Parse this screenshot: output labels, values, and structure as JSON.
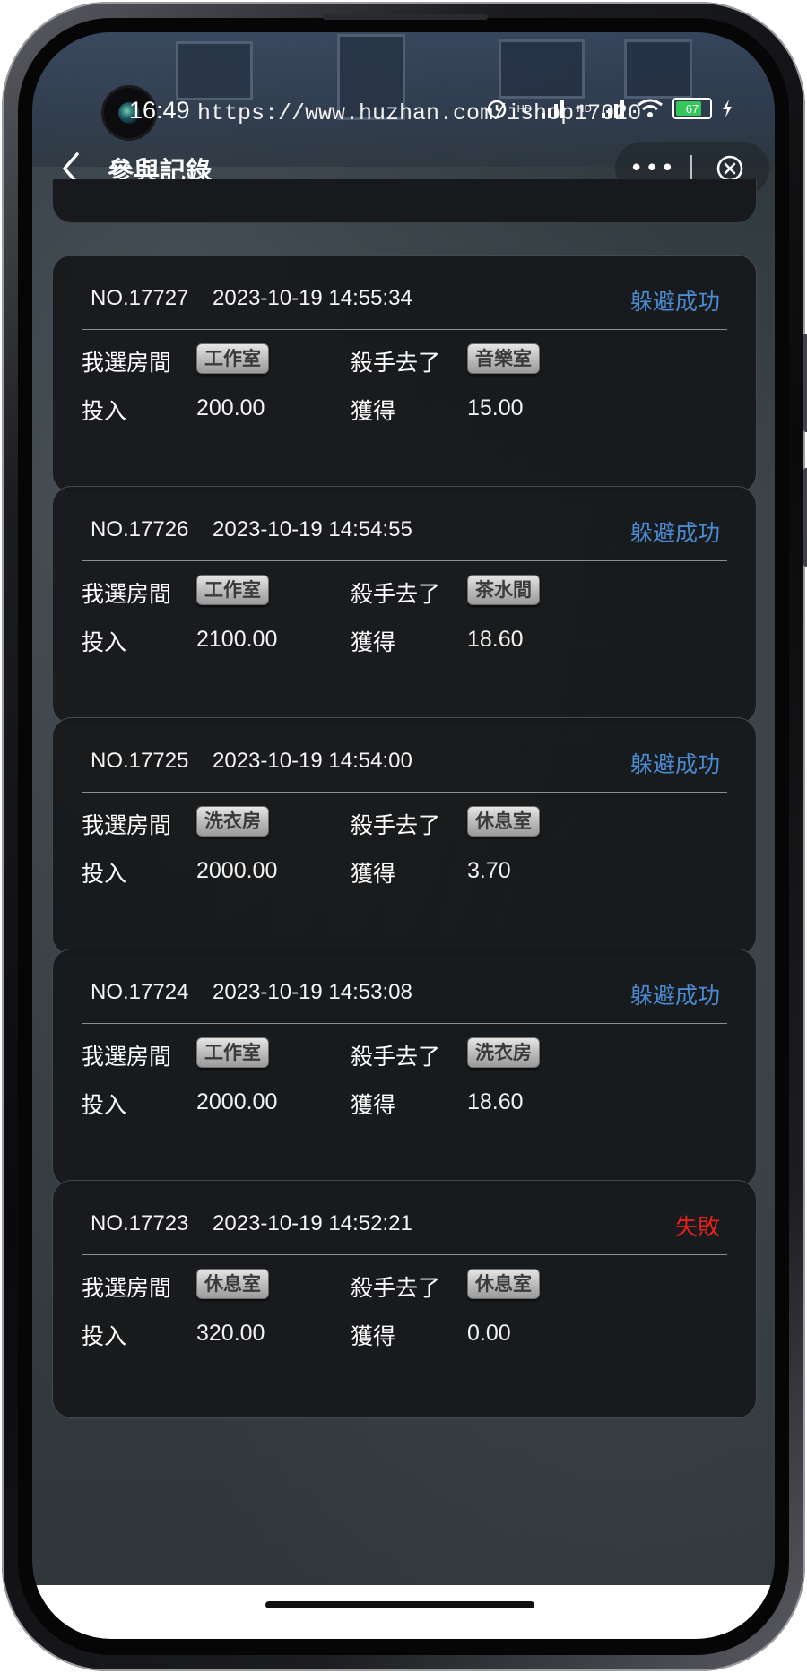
{
  "status_bar": {
    "time": "16:49",
    "watermark": "https://www.huzhan.com/ishop17020",
    "battery": "67",
    "icons": [
      "alarm-icon",
      "signal-icon",
      "wifi-icon",
      "battery-icon",
      "charging-icon"
    ],
    "hd1": "HD",
    "hd2": "HD"
  },
  "nav": {
    "title": "參與記錄",
    "more": "•••"
  },
  "colors": {
    "success": "#4a8bd1",
    "fail": "#e8221b"
  },
  "labels": {
    "my_room": "我選房間",
    "killer_went": "殺手去了",
    "invest": "投入",
    "gain": "獲得"
  },
  "records": [
    {
      "no": "NO.17727",
      "time": "2023-10-19 14:55:34",
      "status": "躲避成功",
      "my_room": "工作室",
      "killer_room": "音樂室",
      "invest": "200.00",
      "gain": "15.00"
    },
    {
      "no": "NO.17726",
      "time": "2023-10-19 14:54:55",
      "status": "躲避成功",
      "my_room": "工作室",
      "killer_room": "茶水間",
      "invest": "2100.00",
      "gain": "18.60"
    },
    {
      "no": "NO.17725",
      "time": "2023-10-19 14:54:00",
      "status": "躲避成功",
      "my_room": "洗衣房",
      "killer_room": "休息室",
      "invest": "2000.00",
      "gain": "3.70"
    },
    {
      "no": "NO.17724",
      "time": "2023-10-19 14:53:08",
      "status": "躲避成功",
      "my_room": "工作室",
      "killer_room": "洗衣房",
      "invest": "2000.00",
      "gain": "18.60"
    },
    {
      "no": "NO.17723",
      "time": "2023-10-19 14:52:21",
      "status": "失敗",
      "my_room": "休息室",
      "killer_room": "休息室",
      "invest": "320.00",
      "gain": "0.00"
    }
  ]
}
